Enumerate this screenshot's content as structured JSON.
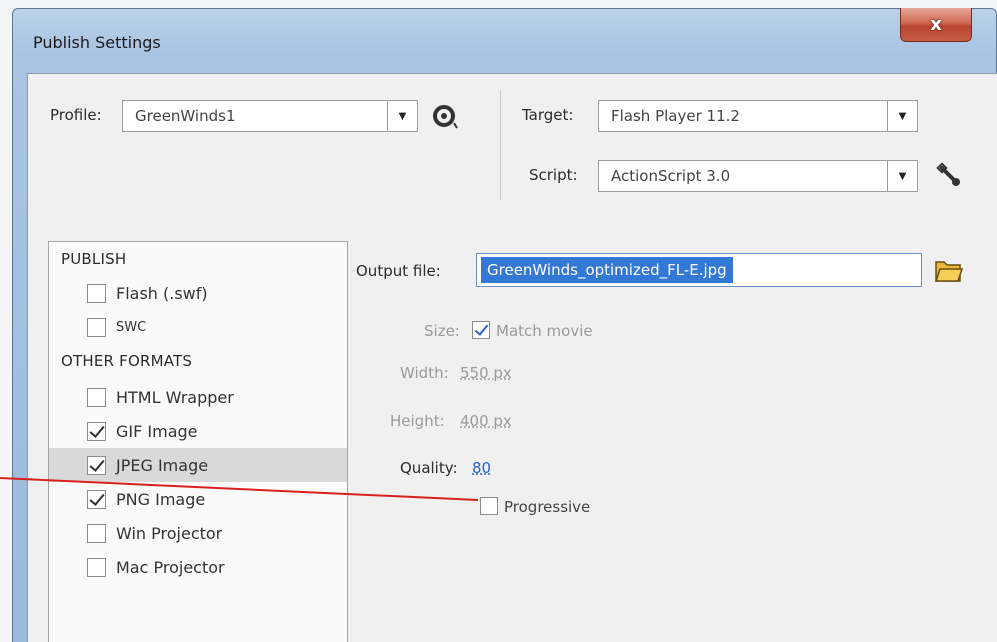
{
  "window": {
    "title": "Publish Settings",
    "close_label": "x"
  },
  "profile": {
    "label": "Profile:",
    "value": "GreenWinds1"
  },
  "target": {
    "label": "Target:",
    "value": "Flash Player 11.2"
  },
  "script": {
    "label": "Script:",
    "value": "ActionScript 3.0"
  },
  "sidebar": {
    "publish_heading": "PUBLISH",
    "other_heading": "OTHER FORMATS",
    "publish_items": [
      {
        "label": "Flash (.swf)",
        "checked": false
      },
      {
        "label": "SWC",
        "checked": false
      }
    ],
    "other_items": [
      {
        "label": "HTML Wrapper",
        "checked": false
      },
      {
        "label": "GIF Image",
        "checked": true
      },
      {
        "label": "JPEG Image",
        "checked": true,
        "selected": true
      },
      {
        "label": "PNG Image",
        "checked": true
      },
      {
        "label": "Win Projector",
        "checked": false
      },
      {
        "label": "Mac Projector",
        "checked": false
      }
    ]
  },
  "jpeg_settings": {
    "output_label": "Output file:",
    "output_value": "GreenWinds_optimized_FL-E.jpg",
    "size_label": "Size:",
    "match_movie_label": "Match movie",
    "match_movie_checked": true,
    "width_label": "Width:",
    "width_value": "550 px",
    "height_label": "Height:",
    "height_value": "400 px",
    "quality_label": "Quality:",
    "quality_value": "80",
    "progressive_label": "Progressive",
    "progressive_checked": false
  },
  "colors": {
    "selection": "#3478d6",
    "callout_line": "#d8201c",
    "link_value": "#2a62c9"
  }
}
